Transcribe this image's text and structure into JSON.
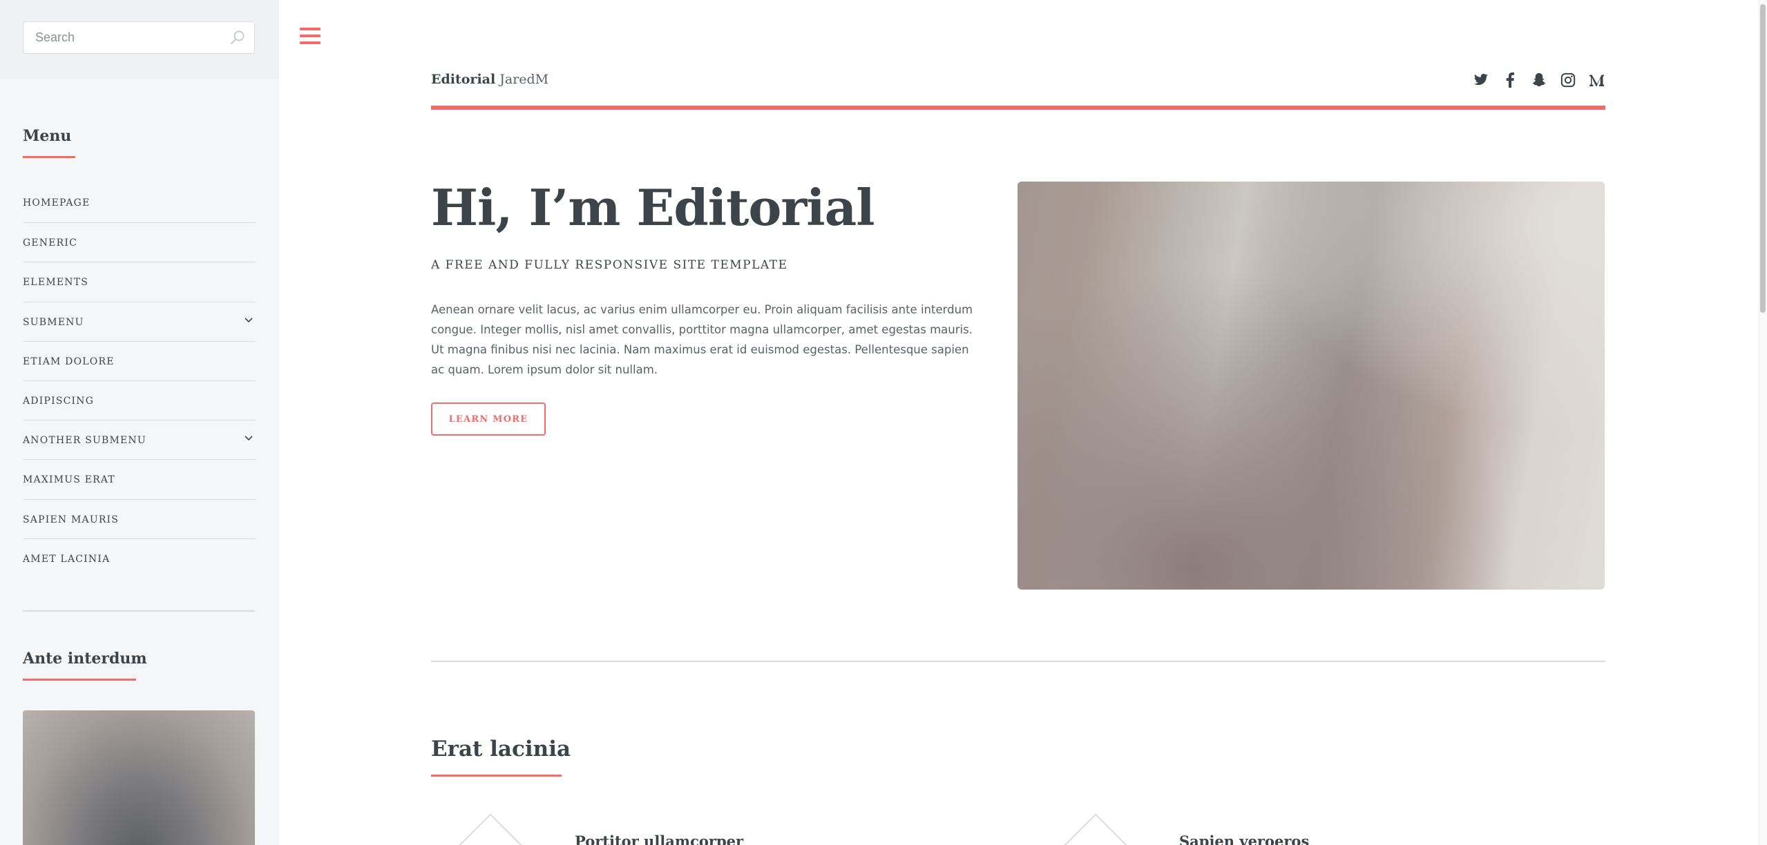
{
  "search": {
    "placeholder": "Search"
  },
  "sidebar": {
    "menu_heading": "Menu",
    "menu_items": [
      {
        "label": "Homepage",
        "has_submenu": false
      },
      {
        "label": "Generic",
        "has_submenu": false
      },
      {
        "label": "Elements",
        "has_submenu": false
      },
      {
        "label": "Submenu",
        "has_submenu": true
      },
      {
        "label": "Etiam Dolore",
        "has_submenu": false
      },
      {
        "label": "Adipiscing",
        "has_submenu": false
      },
      {
        "label": "Another Submenu",
        "has_submenu": true
      },
      {
        "label": "Maximus Erat",
        "has_submenu": false
      },
      {
        "label": "Sapien Mauris",
        "has_submenu": false
      },
      {
        "label": "Amet Lacinia",
        "has_submenu": false
      }
    ],
    "second_heading": "Ante interdum"
  },
  "header": {
    "logo_bold": "Editorial",
    "logo_sub": "JaredM",
    "social_icons": [
      "twitter-icon",
      "facebook-icon",
      "snapchat-icon",
      "instagram-icon",
      "medium-icon"
    ]
  },
  "hero": {
    "title": "Hi, I’m Editorial",
    "subtitle": "A free and fully responsive site template",
    "text": "Aenean ornare velit lacus, ac varius enim ullamcorper eu. Proin aliquam facilisis ante interdum congue. Integer mollis, nisl amet convallis, porttitor magna ullamcorper, amet egestas mauris. Ut magna finibus nisi nec lacinia. Nam maximus erat id euismod egestas. Pellentesque sapien ac quam. Lorem ipsum dolor sit nullam.",
    "button": "Learn More"
  },
  "section": {
    "title": "Erat lacinia",
    "features": [
      {
        "title": "Portitor ullamcorper"
      },
      {
        "title": "Sapien veroeros"
      }
    ]
  },
  "colors": {
    "accent": "#f56a6a",
    "heading": "#3d4449",
    "text": "#7f888f",
    "sidebar_bg": "#f5f6f7"
  }
}
